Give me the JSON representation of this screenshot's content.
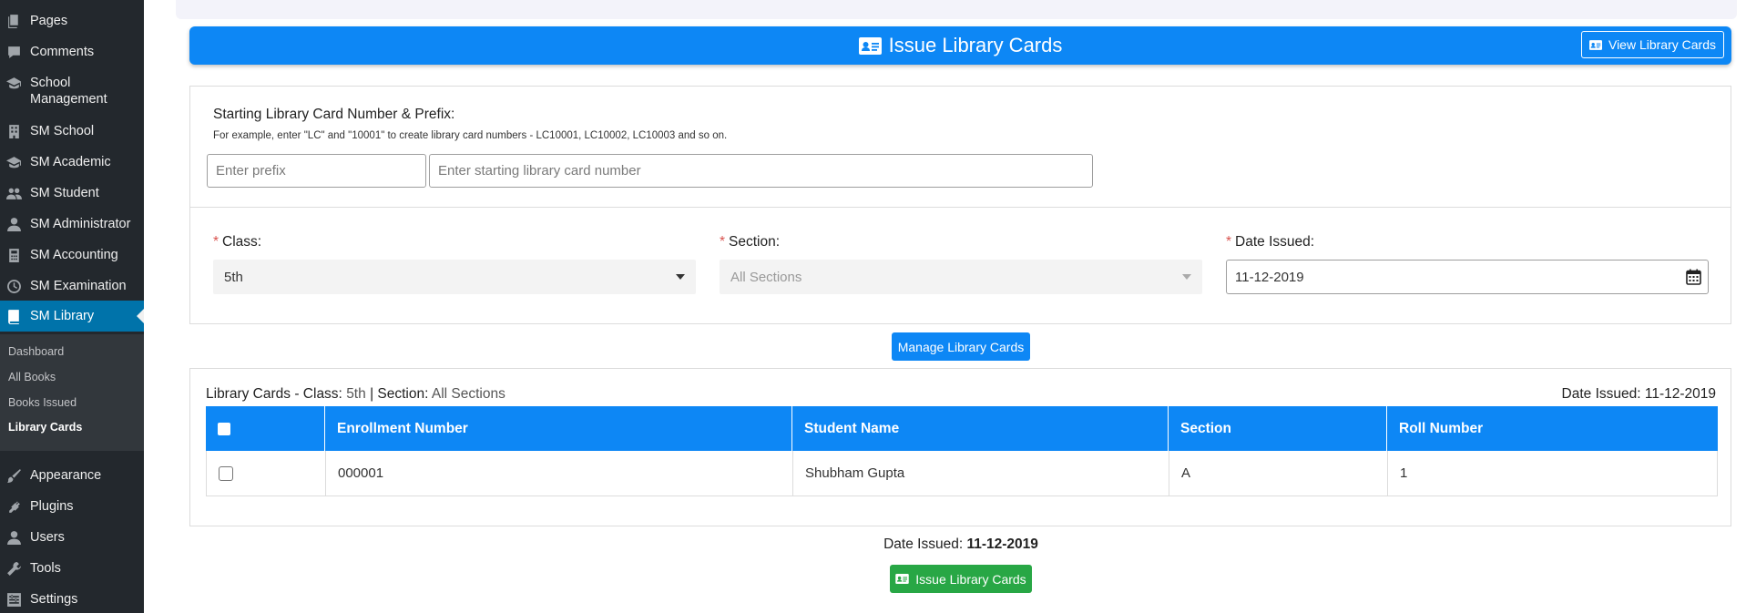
{
  "sidebar": {
    "items": [
      {
        "label": "Pages",
        "icon": "pages-icon"
      },
      {
        "label": "Comments",
        "icon": "comments-icon"
      },
      {
        "label": "School Management",
        "icon": "graduation-cap-icon"
      },
      {
        "label": "SM School",
        "icon": "building-icon"
      },
      {
        "label": "SM Academic",
        "icon": "graduation-cap-icon"
      },
      {
        "label": "SM Student",
        "icon": "users-icon"
      },
      {
        "label": "SM Administrator",
        "icon": "user-tie-icon"
      },
      {
        "label": "SM Accounting",
        "icon": "calculator-icon"
      },
      {
        "label": "SM Examination",
        "icon": "clock-icon"
      },
      {
        "label": "SM Library",
        "icon": "book-icon",
        "active": true
      },
      {
        "label": "Appearance",
        "icon": "paintbrush-icon"
      },
      {
        "label": "Plugins",
        "icon": "plug-icon"
      },
      {
        "label": "Users",
        "icon": "user-icon"
      },
      {
        "label": "Tools",
        "icon": "wrench-icon"
      },
      {
        "label": "Settings",
        "icon": "settings-icon"
      }
    ],
    "submenu": [
      {
        "label": "Dashboard"
      },
      {
        "label": "All Books"
      },
      {
        "label": "Books Issued"
      },
      {
        "label": "Library Cards",
        "current": true
      }
    ]
  },
  "header": {
    "title": "Issue Library Cards",
    "view_button": "View Library Cards",
    "color": "#0d87f5"
  },
  "prefix_panel": {
    "label": "Starting Library Card Number & Prefix:",
    "hint": "For example, enter \"LC\" and \"10001\" to create library card numbers - LC10001, LC10002, LC10003 and so on.",
    "prefix_placeholder": "Enter prefix",
    "number_placeholder": "Enter starting library card number"
  },
  "filters": {
    "required_mark": "*",
    "class_label": "Class:",
    "class_value": "5th",
    "section_label": "Section:",
    "section_value": "All Sections",
    "date_label": "Date Issued:",
    "date_value": "11-12-2019"
  },
  "manage_button": "Manage Library Cards",
  "table": {
    "caption_prefix": "Library Cards - Class:",
    "caption_class": "5th",
    "caption_sep": "| Section:",
    "caption_section": "All Sections",
    "date_label": "Date Issued:",
    "date_value": "11-12-2019",
    "columns": [
      "Enrollment Number",
      "Student Name",
      "Section",
      "Roll Number"
    ],
    "rows": [
      {
        "enrollment": "000001",
        "name": "Shubham Gupta",
        "section": "A",
        "roll": "1"
      }
    ]
  },
  "footer": {
    "date_label": "Date Issued:",
    "date_value": "11-12-2019",
    "issue_button": "Issue Library Cards",
    "issue_color": "#28a745"
  }
}
